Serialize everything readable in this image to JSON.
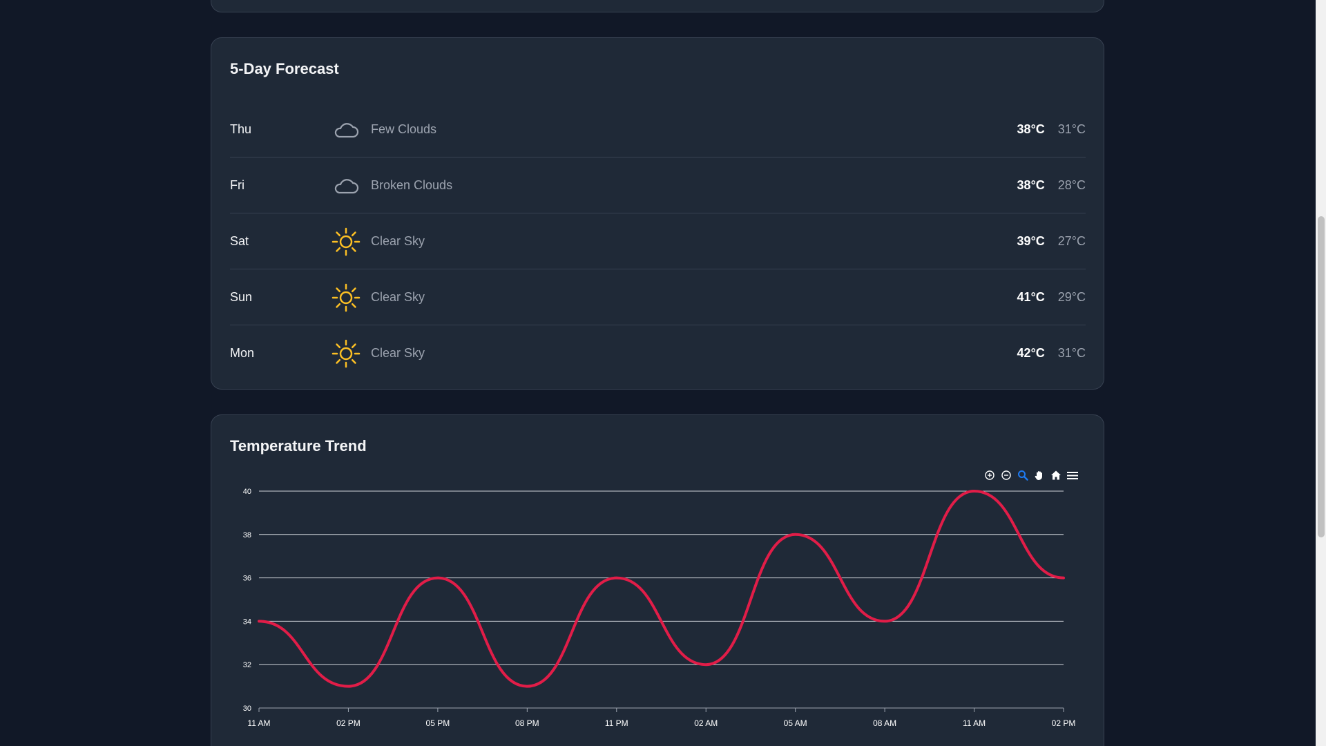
{
  "forecast": {
    "title": "5-Day Forecast",
    "days": [
      {
        "day": "Thu",
        "icon": "cloud-icon",
        "desc": "Few Clouds",
        "high": "38°C",
        "low": "31°C"
      },
      {
        "day": "Fri",
        "icon": "cloud-icon",
        "desc": "Broken Clouds",
        "high": "38°C",
        "low": "28°C"
      },
      {
        "day": "Sat",
        "icon": "sun-icon",
        "desc": "Clear Sky",
        "high": "39°C",
        "low": "27°C"
      },
      {
        "day": "Sun",
        "icon": "sun-icon",
        "desc": "Clear Sky",
        "high": "41°C",
        "low": "29°C"
      },
      {
        "day": "Mon",
        "icon": "sun-icon",
        "desc": "Clear Sky",
        "high": "42°C",
        "low": "31°C"
      }
    ]
  },
  "trend": {
    "title": "Temperature Trend",
    "toolbar": [
      "zoom-in-icon",
      "zoom-out-icon",
      "zoom-selection-icon",
      "pan-hand-icon",
      "reset-home-icon",
      "menu-icon"
    ],
    "active_tool": "zoom-selection-icon"
  },
  "colors": {
    "line": "#e11d48",
    "sun": "#fbbf24",
    "cloud": "#9ca3af",
    "accent": "#1d7af3"
  },
  "chart_data": {
    "type": "line",
    "title": "",
    "xlabel": "",
    "ylabel": "",
    "categories": [
      "11 AM",
      "02 PM",
      "05 PM",
      "08 PM",
      "11 PM",
      "02 AM",
      "05 AM",
      "08 AM",
      "11 AM",
      "02 PM"
    ],
    "series": [
      {
        "values": [
          34,
          31,
          36,
          31,
          36,
          32,
          38,
          34,
          40,
          36
        ]
      }
    ],
    "ylim": [
      30,
      40
    ],
    "yticks": [
      30,
      32,
      34,
      36,
      38,
      40
    ],
    "grid": true,
    "legend": "none"
  }
}
